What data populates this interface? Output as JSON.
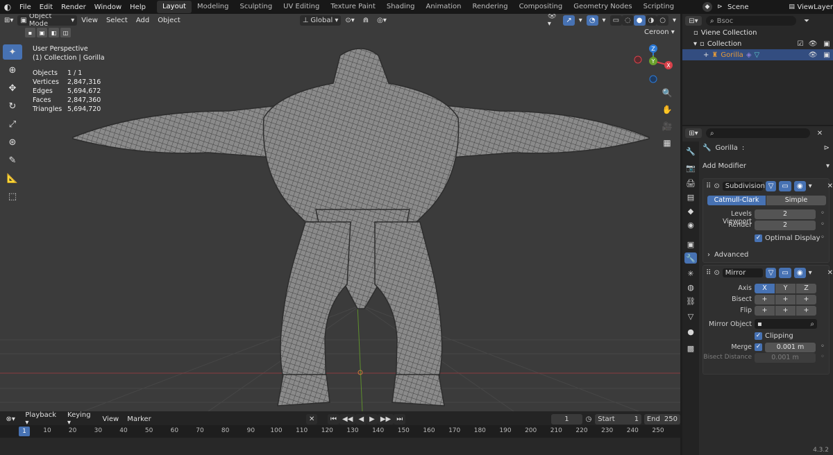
{
  "topbar": {
    "menus": [
      "File",
      "Edit",
      "Render",
      "Window",
      "Help"
    ],
    "workspaces": [
      "Layout",
      "Modeling",
      "Sculpting",
      "UV Editing",
      "Texture Paint",
      "Shading",
      "Animation",
      "Rendering",
      "Compositing",
      "Geometry Nodes",
      "Scripting"
    ],
    "active_workspace": "Layout",
    "scene": "Scene",
    "view_layer": "ViewLayer"
  },
  "viewport": {
    "mode": "Object Mode",
    "menus": [
      "View",
      "Select",
      "Add",
      "Object"
    ],
    "transform_orientation": "Global",
    "perspective": "User Perspective",
    "collection_path": "(1) Collection | Gorilla",
    "stats": [
      {
        "k": "Objects",
        "v": "1 / 1"
      },
      {
        "k": "Vertices",
        "v": "2,847,316"
      },
      {
        "k": "Edges",
        "v": "5,694,672"
      },
      {
        "k": "Faces",
        "v": "2,847,360"
      },
      {
        "k": "Triangles",
        "v": "5,694,720"
      }
    ],
    "camera_label": "Ceroon",
    "gizmo": {
      "x": "X",
      "y": "Y",
      "z": "Z"
    }
  },
  "timeline": {
    "menus": [
      "Playback",
      "Keying",
      "View",
      "Marker"
    ],
    "current_frame": "1",
    "start_label": "Start",
    "start": "1",
    "end_label": "End",
    "end": "250",
    "ticks": [
      "1",
      "10",
      "20",
      "30",
      "40",
      "50",
      "60",
      "70",
      "80",
      "90",
      "100",
      "110",
      "120",
      "130",
      "140",
      "150",
      "160",
      "170",
      "180",
      "190",
      "200",
      "210",
      "220",
      "230",
      "240",
      "250"
    ]
  },
  "outliner": {
    "search_placeholder": "Bsoc",
    "rows": [
      "Viene Collection",
      "Collection",
      "Gorilla"
    ]
  },
  "properties": {
    "object_name": "Gorilla",
    "add_modifier": "Add Modifier",
    "subdivision": {
      "name": "Subdivision",
      "method_a": "Catmull-Clark",
      "method_b": "Simple",
      "levels_viewport_label": "Levels Viewport",
      "levels_viewport": "2",
      "render_label": "Render",
      "render": "2",
      "optimal_display": "Optimal Display",
      "advanced": "Advanced"
    },
    "mirror": {
      "name": "Mirror",
      "axis_label": "Axis",
      "bisect_label": "Bisect",
      "flip_label": "Flip",
      "x": "X",
      "y": "Y",
      "z": "Z",
      "plus": "+",
      "mirror_object": "Mirror Object",
      "clipping": "Clipping",
      "merge_label": "Merge",
      "merge": "0.001 m",
      "bisect_distance_label": "Bisect Distance",
      "bisect_distance": "0.001 m"
    }
  },
  "version": "4.3.2",
  "colors": {
    "accent": "#4772b3",
    "x_axis": "#d8414a",
    "y_axis": "#6aa12c",
    "z_axis": "#2d7ad6",
    "selected": "#e59b3a"
  }
}
